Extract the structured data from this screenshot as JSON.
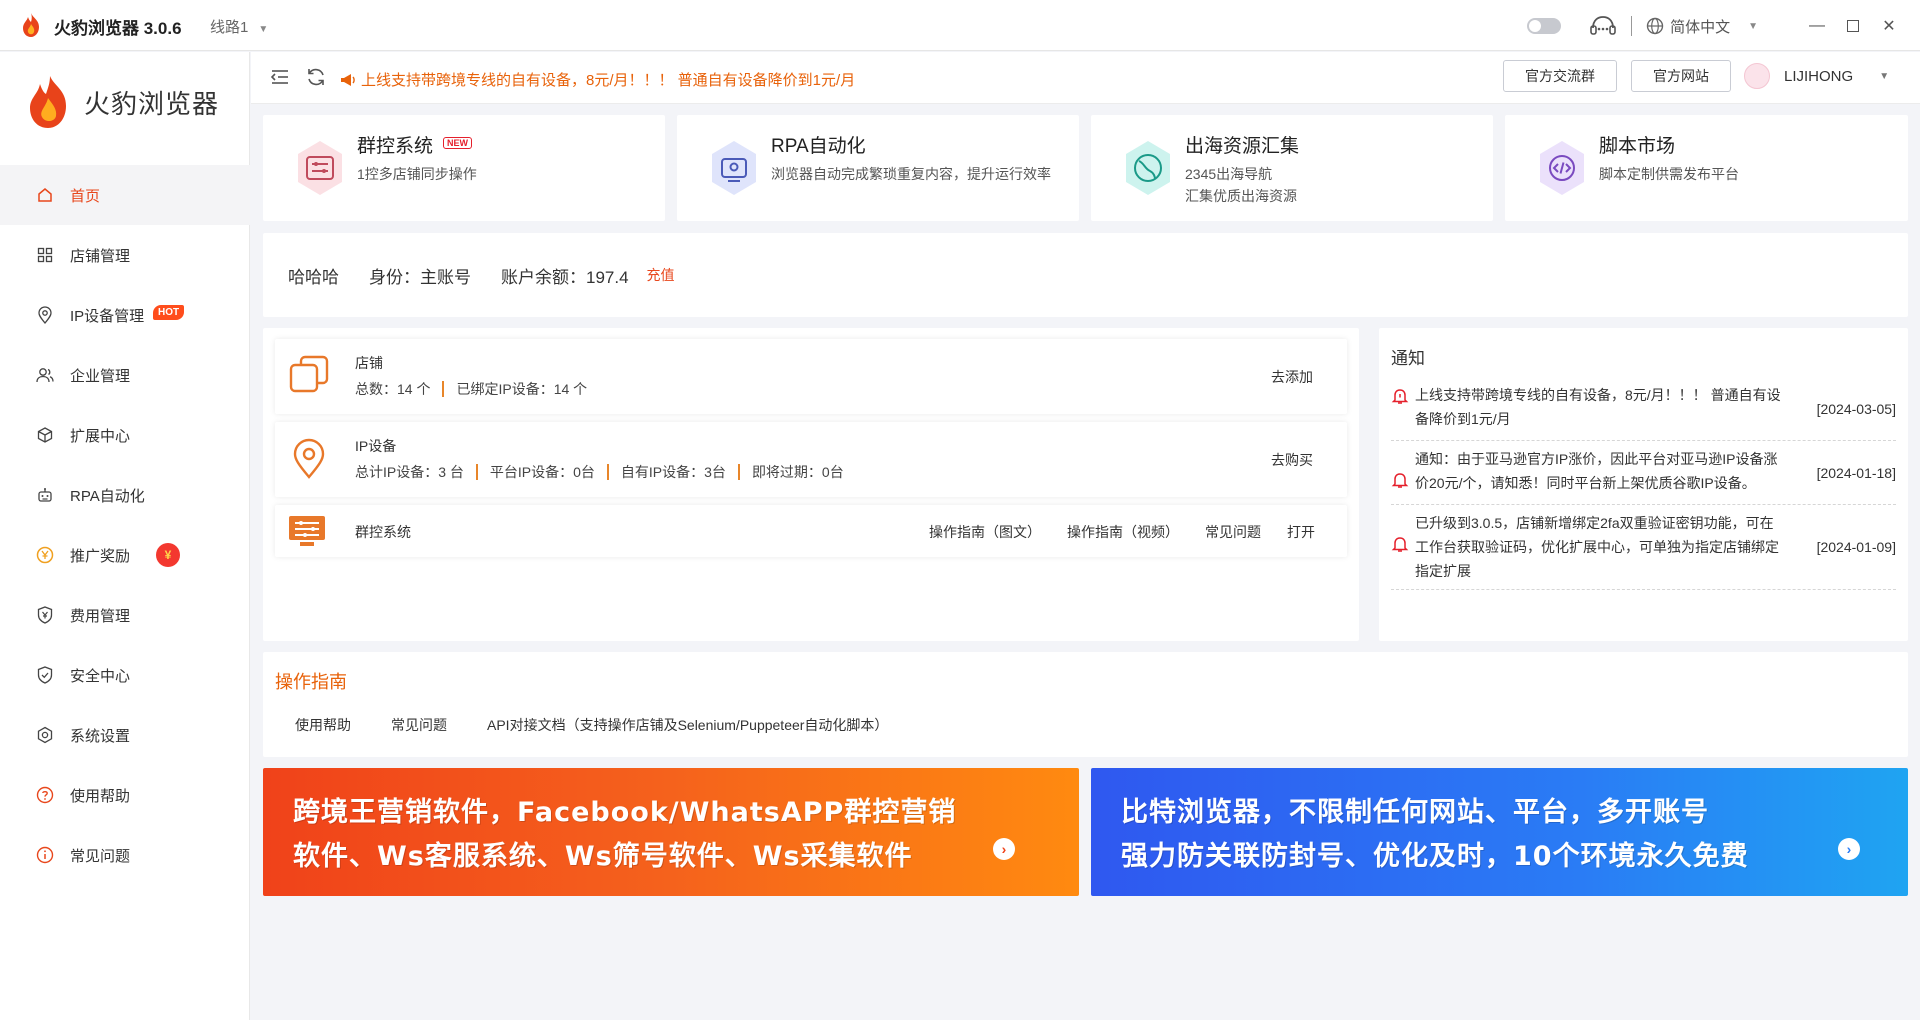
{
  "window": {
    "title": "火豹浏览器 3.0.6",
    "line": "线路1",
    "language": "简体中文"
  },
  "brand": {
    "name": "火豹浏览器"
  },
  "sidebar": {
    "items": [
      {
        "label": "首页",
        "icon": "home-icon",
        "active": true
      },
      {
        "label": "店铺管理",
        "icon": "grid-icon"
      },
      {
        "label": "IP设备管理",
        "icon": "location-icon",
        "badge": "HOT"
      },
      {
        "label": "企业管理",
        "icon": "users-icon"
      },
      {
        "label": "扩展中心",
        "icon": "cube-icon"
      },
      {
        "label": "RPA自动化",
        "icon": "robot-icon"
      },
      {
        "label": "推广奖励",
        "icon": "coin-icon",
        "badge": "¥"
      },
      {
        "label": "费用管理",
        "icon": "shield-money-icon"
      },
      {
        "label": "安全中心",
        "icon": "shield-check-icon"
      },
      {
        "label": "系统设置",
        "icon": "settings-icon"
      },
      {
        "label": "使用帮助",
        "icon": "help-icon"
      },
      {
        "label": "常见问题",
        "icon": "info-icon"
      }
    ]
  },
  "topbar": {
    "announcement": "上线支持带跨境专线的自有设备，8元/月！！！ 普通自有设备降价到1元/月",
    "btn_group": "官方交流群",
    "btn_site": "官方网站",
    "username": "LIJIHONG"
  },
  "features": [
    {
      "title": "群控系统",
      "badge": "NEW",
      "desc": "1控多店铺同步操作"
    },
    {
      "title": "RPA自动化",
      "desc": "浏览器自动完成繁琐重复内容，提升运行效率"
    },
    {
      "title": "出海资源汇集",
      "desc": "2345出海导航",
      "desc2": "汇集优质出海资源"
    },
    {
      "title": "脚本市场",
      "desc": "脚本定制供需发布平台"
    }
  ],
  "account": {
    "name": "哈哈哈",
    "role": "身份：主账号",
    "balance": "账户余额：197.4",
    "recharge": "充值"
  },
  "store": {
    "title": "店铺",
    "total": "总数：14 个",
    "bound": "已绑定IP设备：14 个",
    "action": "去添加"
  },
  "ip": {
    "title": "IP设备",
    "total": "总计IP设备：3 台",
    "platform": "平台IP设备：0台",
    "own": "自有IP设备：3台",
    "expiring": "即将过期：0台",
    "action": "去购买"
  },
  "group": {
    "title": "群控系统",
    "link1": "操作指南（图文）",
    "link2": "操作指南（视频）",
    "link3": "常见问题",
    "link4": "打开"
  },
  "notice": {
    "title": "通知",
    "items": [
      {
        "text": "上线支持带跨境专线的自有设备，8元/月！！！ 普通自有设备降价到1元/月",
        "date": "[2024-03-05]"
      },
      {
        "text": "通知：由于亚马逊官方IP涨价，因此平台对亚马逊IP设备涨价20元/个，请知悉！同时平台新上架优质谷歌IP设备。",
        "date": "[2024-01-18]"
      },
      {
        "text": "已升级到3.0.5，店铺新增绑定2fa双重验证密钥功能，可在工作台获取验证码，优化扩展中心，可单独为指定店铺绑定指定扩展",
        "date": "[2024-01-09]"
      }
    ]
  },
  "guide": {
    "title": "操作指南",
    "links": [
      "使用帮助",
      "常见问题",
      "API对接文档（支持操作店铺及Selenium/Puppeteer自动化脚本）"
    ]
  },
  "banners": [
    {
      "line1": "跨境王营销软件，Facebook/WhatsAPP群控营销",
      "line2": "软件、Ws客服系统、Ws筛号软件、Ws采集软件"
    },
    {
      "line1": "比特浏览器，不限制任何网站、平台，多开账号",
      "line2": "强力防关联防封号、优化及时，10个环境永久免费"
    }
  ]
}
